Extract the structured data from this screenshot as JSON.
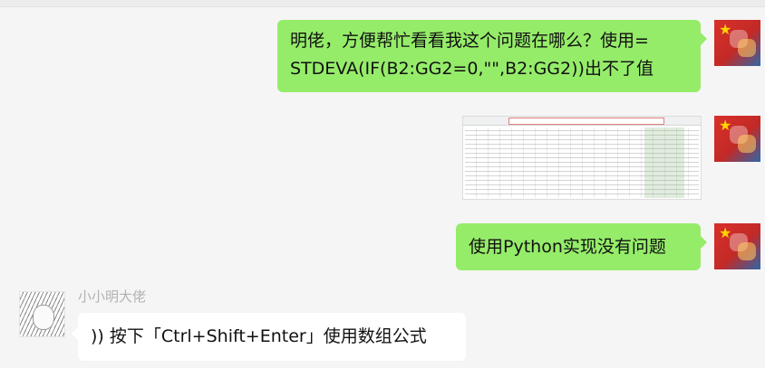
{
  "messages": [
    {
      "direction": "outgoing",
      "type": "text",
      "text_line1": "明佬，方便帮忙看看我这个问题在哪么？使用=",
      "text_line2": "STDEVA(IF(B2:GG2=0,\"\",B2:GG2))出不了值"
    },
    {
      "direction": "outgoing",
      "type": "image",
      "image_desc": "spreadsheet-screenshot"
    },
    {
      "direction": "outgoing",
      "type": "text",
      "text": "使用Python实现没有问题"
    },
    {
      "direction": "incoming",
      "sender": "小小明大佬",
      "type": "text",
      "text": ")) 按下「Ctrl+Shift+Enter」使用数组公式"
    }
  ],
  "colors": {
    "background": "#f5f5f5",
    "outgoing_bubble": "#95ec69",
    "incoming_bubble": "#ffffff",
    "sender_name": "#b2b2b2"
  },
  "icons": {
    "self_avatar": "china-flag-python-avatar",
    "other_avatar": "manga-character-avatar"
  }
}
